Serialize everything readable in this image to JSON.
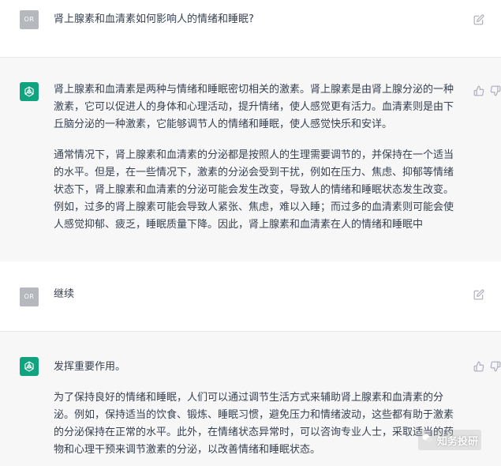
{
  "colors": {
    "assistant_accent": "#10a37f",
    "user_avatar": "#b5b8bd",
    "assistant_bg": "#f7f7f8",
    "text": "#374151",
    "icon": "#acacbe"
  },
  "messages": [
    {
      "role": "user",
      "avatar": "OR",
      "text": "肾上腺素和血清素如何影响人的情绪和睡眠?",
      "action_icon": "edit-icon"
    },
    {
      "role": "assistant",
      "avatar_icon": "openai-logo-icon",
      "paragraphs": [
        "肾上腺素和血清素是两种与情绪和睡眠密切相关的激素。肾上腺素是由肾上腺分泌的一种激素，它可以促进人的身体和心理活动，提升情绪，使人感觉更有活力。血清素则是由下丘脑分泌的一种激素，它能够调节人的情绪和睡眠，使人感觉快乐和安详。",
        "通常情况下，肾上腺素和血清素的分泌都是按照人的生理需要调节的，并保持在一个适当的水平。但是，在一些情况下，激素的分泌会受到干扰，例如在压力、焦虑、抑郁等情绪状态下，肾上腺素和血清素的分泌可能会发生改变，导致人的情绪和睡眠状态发生改变。例如，过多的肾上腺素可能会导致人紧张、焦虑，难以入睡；而过多的血清素则可能会使人感觉抑郁、疲乏，睡眠质量下降。因此，肾上腺素和血清素在人的情绪和睡眠中"
      ],
      "action_icons": [
        "thumbs-up-icon",
        "thumbs-down-icon"
      ]
    },
    {
      "role": "user",
      "avatar": "OR",
      "text": "继续",
      "action_icon": "edit-icon"
    },
    {
      "role": "assistant",
      "avatar_icon": "openai-logo-icon",
      "paragraphs": [
        "发挥重要作用。",
        "为了保持良好的情绪和睡眠，人们可以通过调节生活方式来辅助肾上腺素和血清素的分泌。例如，保持适当的饮食、锻炼、睡眠习惯，避免压力和情绪波动，这些都有助于激素的分泌保持在正常的水平。此外，在情绪状态异常时，可以咨询专业人士，采取适当的药物和心理干预来调节激素的分泌，以改善情绪和睡眠状态。"
      ],
      "action_icons": [
        "thumbs-up-icon",
        "thumbs-down-icon"
      ]
    }
  ],
  "watermark": {
    "text": "知务投研",
    "icon": "wechat-icon"
  }
}
